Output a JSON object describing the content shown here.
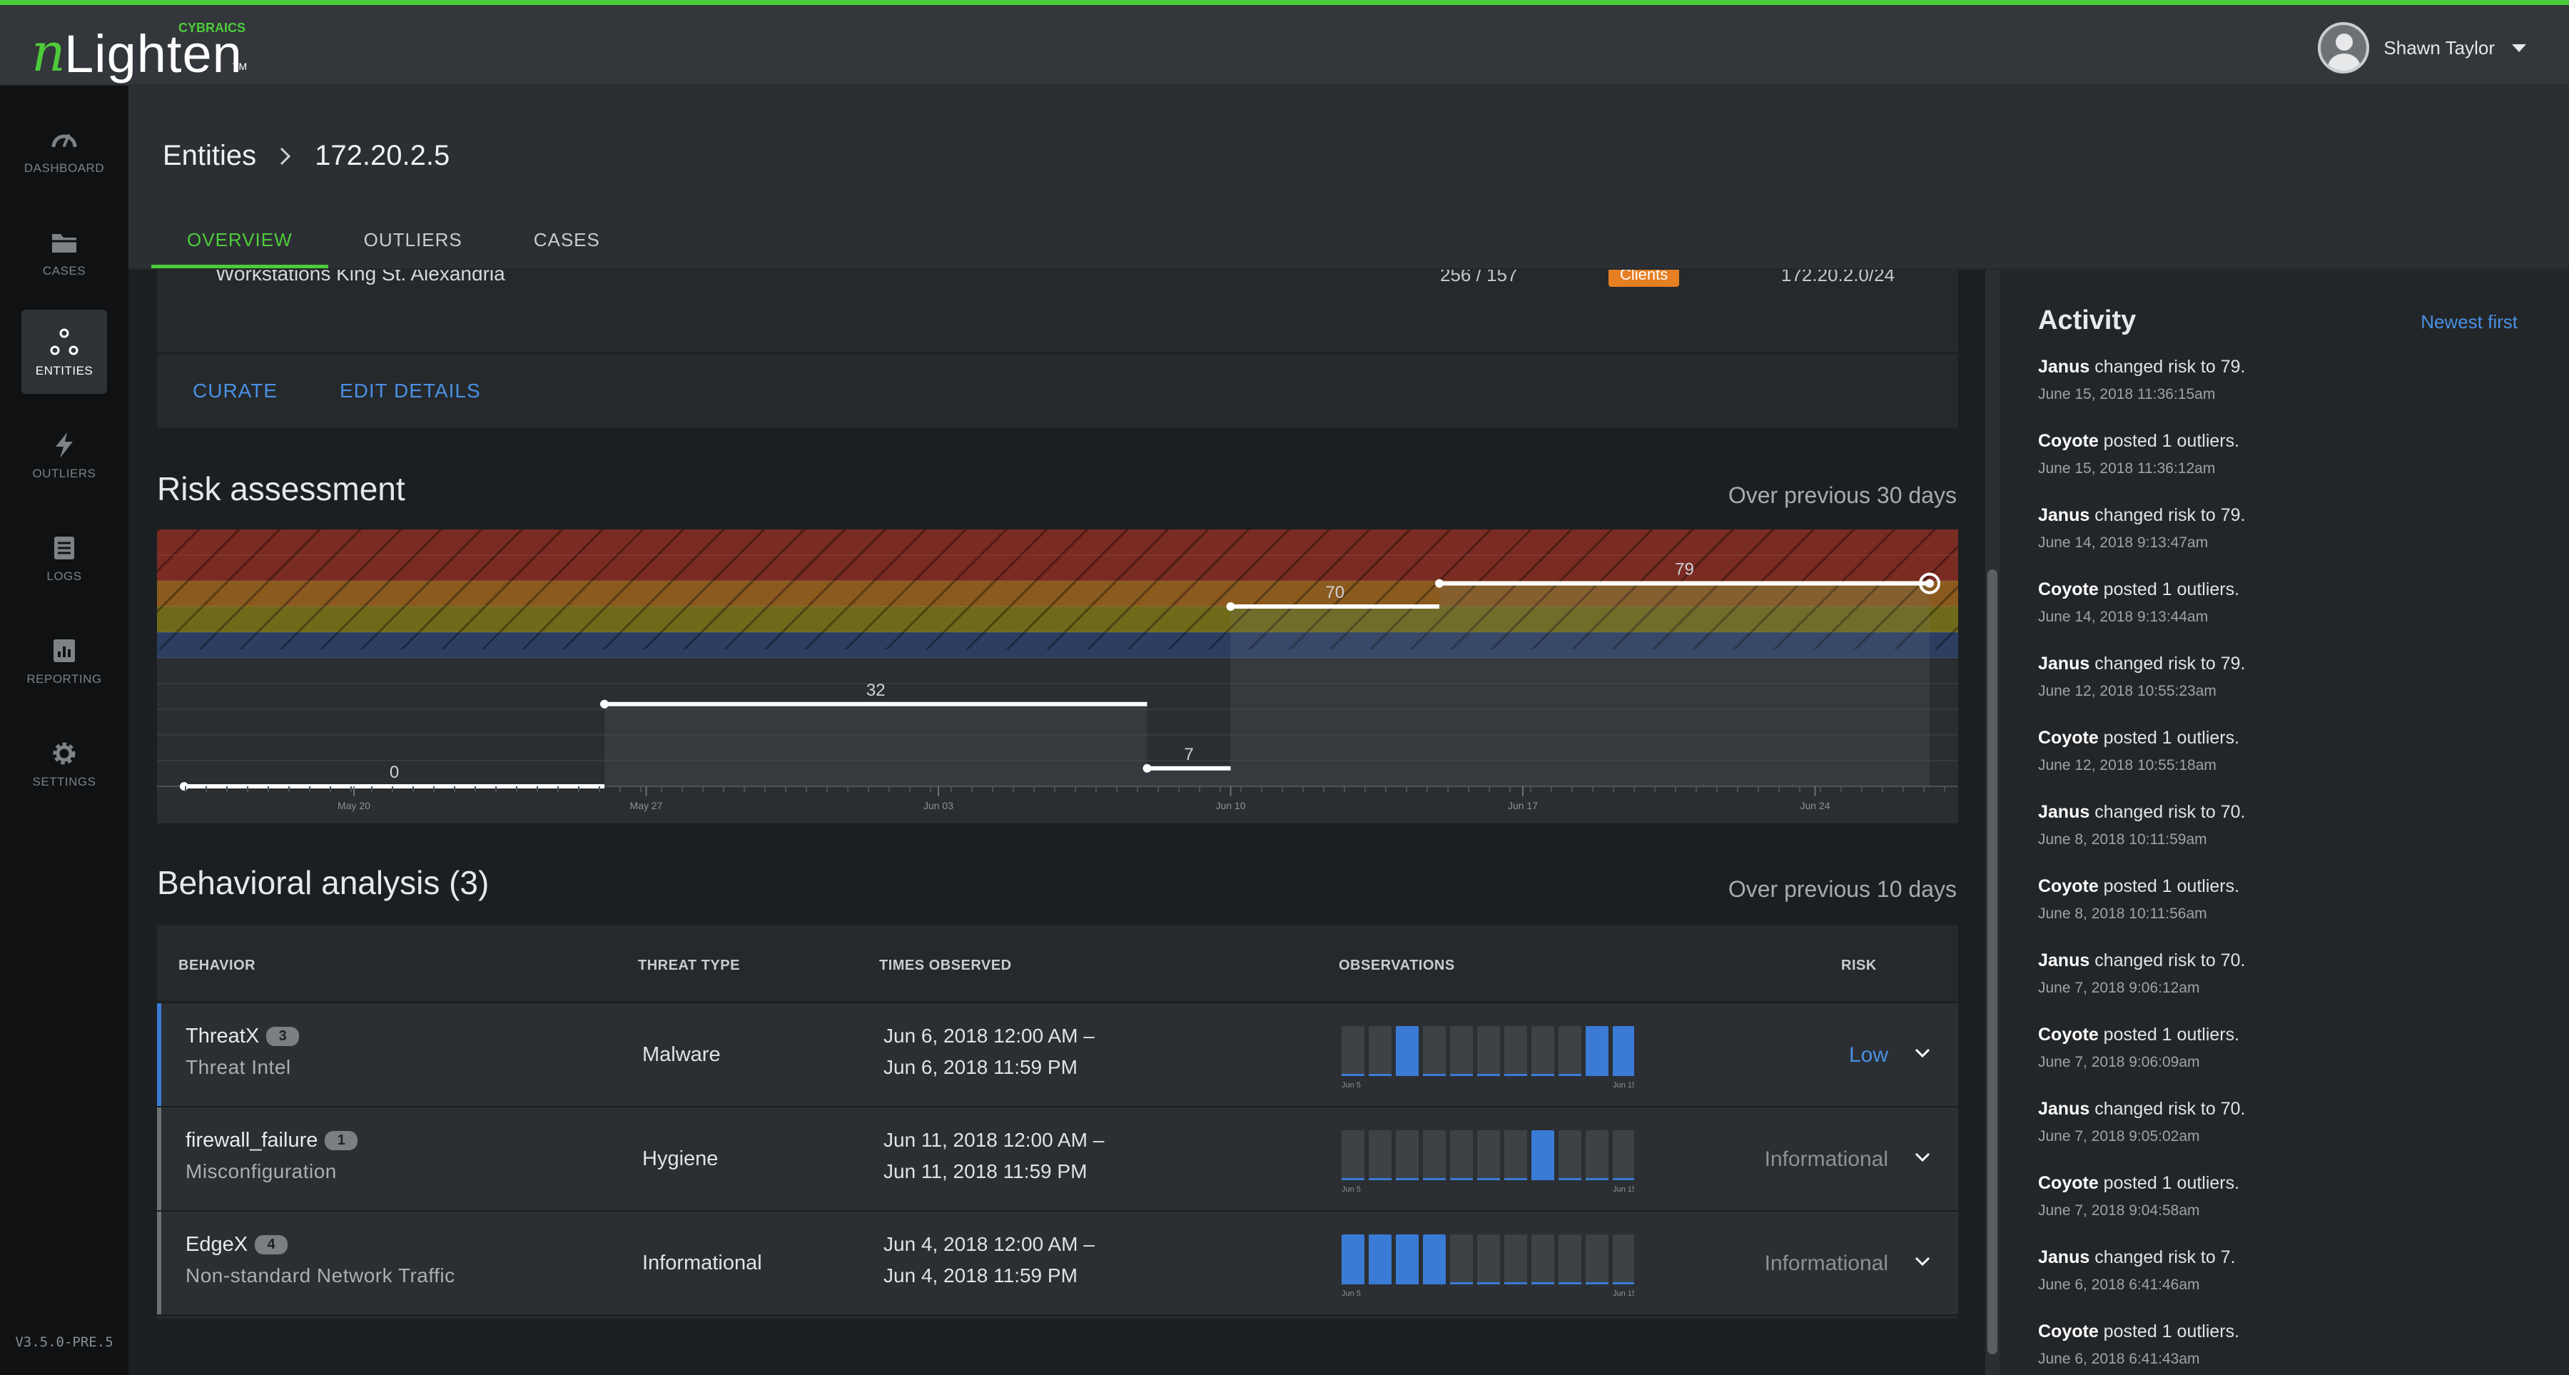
{
  "brand": {
    "logo_n": "n",
    "logo_text": "Lighten",
    "maker": "CYBRAICS",
    "tm": "TM"
  },
  "user": {
    "name": "Shawn Taylor"
  },
  "nav": {
    "items": [
      {
        "label": "Dashboard",
        "icon": "gauge-icon"
      },
      {
        "label": "Cases",
        "icon": "folder-icon"
      },
      {
        "label": "Entities",
        "icon": "network-nodes-icon",
        "active": true
      },
      {
        "label": "Outliers",
        "icon": "lightning-icon"
      },
      {
        "label": "Logs",
        "icon": "log-list-icon"
      },
      {
        "label": "Reporting",
        "icon": "bar-chart-icon"
      },
      {
        "label": "Settings",
        "icon": "gear-icon"
      }
    ],
    "version": "V3.5.0-PRE.5"
  },
  "breadcrumb": {
    "root": "Entities",
    "current": "172.20.2.5"
  },
  "tabs": [
    "OVERVIEW",
    "OUTLIERS",
    "CASES"
  ],
  "entity_group": {
    "name": "Workstations King St. Alexandria",
    "counts": "256 / 157",
    "badge": "Clients",
    "subnet": "172.20.2.0/24"
  },
  "actions": {
    "curate": "CURATE",
    "edit": "EDIT DETAILS"
  },
  "risk": {
    "title": "Risk assessment",
    "note": "Over previous 30 days"
  },
  "chart_data": {
    "type": "line",
    "title": "Risk assessment",
    "x_tick_labels": [
      "May 20",
      "May 27",
      "Jun 03",
      "Jun 10",
      "Jun 17",
      "Jun 24"
    ],
    "ylim": [
      0,
      100
    ],
    "bands": [
      {
        "from": 80,
        "to": 100,
        "color": "#7a2b22"
      },
      {
        "from": 70,
        "to": 80,
        "color": "#8a5a1e"
      },
      {
        "from": 60,
        "to": 70,
        "color": "#6f6a1a"
      },
      {
        "from": 50,
        "to": 60,
        "color": "#2c3f63"
      }
    ],
    "steps": [
      {
        "start": "May 20",
        "end": "May 26",
        "value": 0
      },
      {
        "start": "May 26",
        "end": "Jun 08",
        "value": 32
      },
      {
        "start": "Jun 08",
        "end": "Jun 10",
        "value": 7
      },
      {
        "start": "Jun 10",
        "end": "Jun 15",
        "value": 70
      },
      {
        "start": "Jun 15",
        "end": "Jun 29",
        "value": 79
      }
    ],
    "grid": true
  },
  "behavior": {
    "title": "Behavioral analysis (3)",
    "note": "Over previous 10 days",
    "columns": [
      "BEHAVIOR",
      "THREAT TYPE",
      "TIMES OBSERVED",
      "OBSERVATIONS",
      "RISK"
    ],
    "obs_start": "Jun 5",
    "obs_end": "Jun 15",
    "rows": [
      {
        "name": "ThreatX",
        "count": "3",
        "subtitle": "Threat Intel",
        "type": "Malware",
        "time1": "Jun 6, 2018 12:00 AM –",
        "time2": "Jun 6, 2018 11:59 PM",
        "observations": [
          0,
          0,
          1,
          0,
          0,
          0,
          0,
          0,
          0,
          1,
          1
        ],
        "risk": "Low"
      },
      {
        "name": "firewall_failure",
        "count": "1",
        "subtitle": "Misconfiguration",
        "type": "Hygiene",
        "time1": "Jun 11, 2018 12:00 AM –",
        "time2": "Jun 11, 2018 11:59 PM",
        "observations": [
          0,
          0,
          0,
          0,
          0,
          0,
          0,
          1,
          0,
          0,
          0
        ],
        "risk": "Informational"
      },
      {
        "name": "EdgeX",
        "count": "4",
        "subtitle": "Non-standard Network Traffic",
        "type": "Informational",
        "time1": "Jun 4, 2018 12:00 AM –",
        "time2": "Jun 4, 2018 11:59 PM",
        "observations": [
          1,
          1,
          1,
          1,
          0,
          0,
          0,
          0,
          0,
          0,
          0
        ],
        "risk": "Informational"
      }
    ]
  },
  "activity": {
    "title": "Activity",
    "sort": "Newest first",
    "items": [
      {
        "actor": "Janus",
        "text": " changed risk to 79.",
        "time": "June 15, 2018 11:36:15am"
      },
      {
        "actor": "Coyote",
        "text": " posted 1 outliers.",
        "time": "June 15, 2018 11:36:12am"
      },
      {
        "actor": "Janus",
        "text": " changed risk to 79.",
        "time": "June 14, 2018 9:13:47am"
      },
      {
        "actor": "Coyote",
        "text": " posted 1 outliers.",
        "time": "June 14, 2018 9:13:44am"
      },
      {
        "actor": "Janus",
        "text": " changed risk to 79.",
        "time": "June 12, 2018 10:55:23am"
      },
      {
        "actor": "Coyote",
        "text": " posted 1 outliers.",
        "time": "June 12, 2018 10:55:18am"
      },
      {
        "actor": "Janus",
        "text": " changed risk to 70.",
        "time": "June 8, 2018 10:11:59am"
      },
      {
        "actor": "Coyote",
        "text": " posted 1 outliers.",
        "time": "June 8, 2018 10:11:56am"
      },
      {
        "actor": "Janus",
        "text": " changed risk to 70.",
        "time": "June 7, 2018 9:06:12am"
      },
      {
        "actor": "Coyote",
        "text": " posted 1 outliers.",
        "time": "June 7, 2018 9:06:09am"
      },
      {
        "actor": "Janus",
        "text": " changed risk to 70.",
        "time": "June 7, 2018 9:05:02am"
      },
      {
        "actor": "Coyote",
        "text": " posted 1 outliers.",
        "time": "June 7, 2018 9:04:58am"
      },
      {
        "actor": "Janus",
        "text": " changed risk to 7.",
        "time": "June 6, 2018 6:41:46am"
      },
      {
        "actor": "Coyote",
        "text": " posted 1 outliers.",
        "time": "June 6, 2018 6:41:43am"
      }
    ]
  },
  "colors": {
    "accent": "#4ecb3a",
    "link": "#4a90e2",
    "badge": "#e67e22",
    "obs_on": "#3a7bd5",
    "obs_off": "#3d4247"
  }
}
